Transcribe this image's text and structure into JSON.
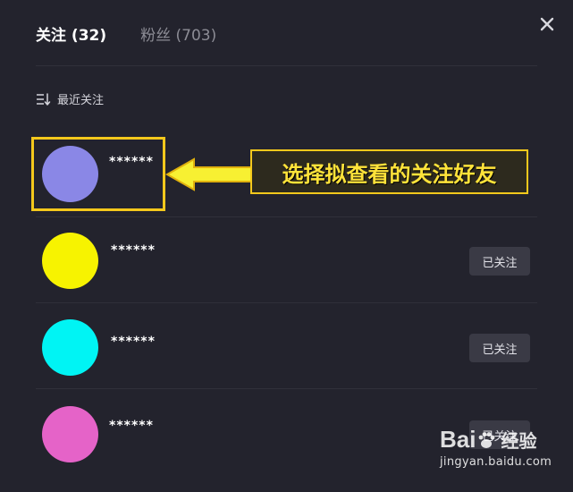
{
  "tabs": [
    {
      "label": "关注 (32)",
      "active": true
    },
    {
      "label": "粉丝 (703)",
      "active": false
    }
  ],
  "close_icon": "close-icon",
  "sort": {
    "icon": "sort-icon",
    "label": "最近关注"
  },
  "follows": [
    {
      "name": "******",
      "avatar_color": "#8a87e6",
      "button": ""
    },
    {
      "name": "******",
      "avatar_color": "#f7f300",
      "button": "已关注"
    },
    {
      "name": "******",
      "avatar_color": "#00f4f4",
      "button": "已关注"
    },
    {
      "name": "******",
      "avatar_color": "#e563c8",
      "button": "已关注"
    }
  ],
  "annotation": {
    "callout_text": "选择拟查看的关注好友",
    "highlight_color": "#f4c81c"
  },
  "watermark": {
    "logo": "Bai  经验",
    "logo_du": "Bai",
    "logo_cn": "经验",
    "url": "jingyan.baidu.com"
  }
}
